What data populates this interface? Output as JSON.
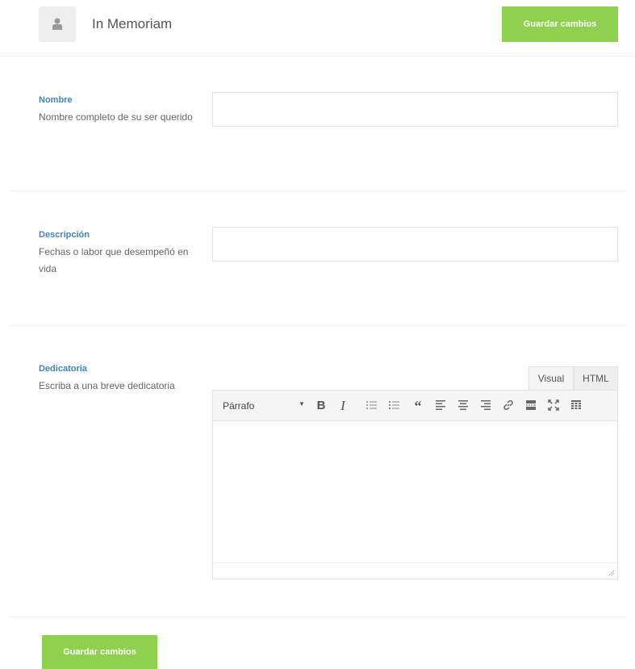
{
  "header": {
    "title": "In Memoriam",
    "save_label": "Guardar cambios",
    "avatar_icon": "user-icon"
  },
  "fields": {
    "nombre": {
      "label": "Nombre",
      "description": "Nombre completo de su ser querido",
      "value": ""
    },
    "descripcion": {
      "label": "Descripción",
      "description": "Fechas o labor que desempeñó en vida",
      "value": ""
    },
    "dedicatoria": {
      "label": "Dedicatoria",
      "description": "Escriba a una breve dedicatoria"
    }
  },
  "editor": {
    "tabs": {
      "visual": "Visual",
      "html": "HTML"
    },
    "format_selected": "Párrafo",
    "toolbar_icons": [
      "bold-icon",
      "italic-icon",
      "bullet-list-icon",
      "numbered-list-icon",
      "blockquote-icon",
      "align-left-icon",
      "align-center-icon",
      "align-right-icon",
      "link-icon",
      "read-more-icon",
      "fullscreen-icon",
      "toolbar-toggle-icon"
    ],
    "content": ""
  },
  "footer": {
    "save_label": "Guardar cambios"
  },
  "colors": {
    "accent": "#8fd14f",
    "label": "#3d86b5"
  }
}
